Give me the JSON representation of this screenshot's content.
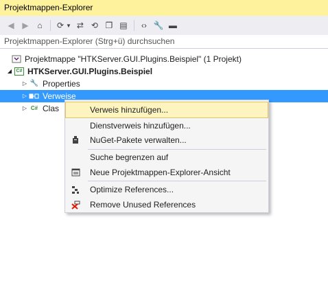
{
  "window": {
    "title": "Projektmappen-Explorer"
  },
  "toolbar": {
    "buttons": [
      {
        "icon": "back-icon"
      },
      {
        "icon": "forward-icon"
      },
      {
        "icon": "home-icon"
      },
      {
        "icon": "history-icon"
      },
      {
        "icon": "sync-icon"
      },
      {
        "icon": "refresh-icon"
      },
      {
        "icon": "collapse-all-icon"
      },
      {
        "icon": "show-all-files-icon"
      },
      {
        "icon": "view-code-icon"
      },
      {
        "icon": "properties-icon"
      },
      {
        "icon": "preview-icon"
      }
    ]
  },
  "search": {
    "placeholder": "Projektmappen-Explorer (Strg+ü) durchsuchen"
  },
  "tree": {
    "solution": "Projektmappe \"HTKServer.GUI.Plugins.Beispiel\" (1 Projekt)",
    "project": "HTKServer.GUI.Plugins.Beispiel",
    "properties": "Properties",
    "references": "Verweise",
    "class_prefix": "Clas"
  },
  "context_menu": {
    "items": [
      {
        "label": "Verweis hinzufügen...",
        "icon": ""
      },
      {
        "label": "Dienstverweis hinzufügen...",
        "icon": ""
      },
      {
        "label": "NuGet-Pakete verwalten...",
        "icon": "nuget-icon"
      },
      {
        "label": "Suche begrenzen auf",
        "icon": ""
      },
      {
        "label": "Neue Projektmappen-Explorer-Ansicht",
        "icon": "new-view-icon"
      },
      {
        "label": "Optimize References...",
        "icon": "optimize-icon"
      },
      {
        "label": "Remove Unused References",
        "icon": "remove-references-icon"
      }
    ]
  },
  "colors": {
    "title_bg": "#fff29d",
    "selection": "#3399ff",
    "menu_highlight": "#fdf4bf"
  }
}
